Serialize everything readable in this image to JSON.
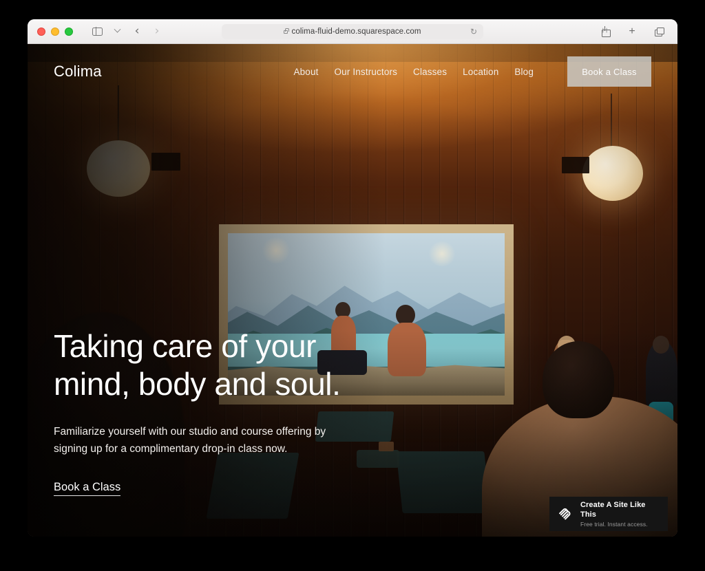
{
  "browser": {
    "url": "colima-fluid-demo.squarespace.com",
    "traffic_lights": [
      "close",
      "minimize",
      "maximize"
    ],
    "icons": {
      "sidebar": "sidebar-icon",
      "tab_group_chevron": "chevron-down-icon",
      "back": "‹",
      "forward": "›",
      "lock": "lock-icon",
      "reload": "↻",
      "share": "share-icon",
      "new_tab": "+",
      "tab_overview": "tab-overview-icon"
    }
  },
  "site": {
    "logo": "Colima",
    "nav": [
      {
        "label": "About"
      },
      {
        "label": "Our Instructors"
      },
      {
        "label": "Classes"
      },
      {
        "label": "Location"
      },
      {
        "label": "Blog"
      }
    ],
    "header_cta": "Book a Class"
  },
  "hero": {
    "heading_line1": "Taking care of your",
    "heading_line2": "mind, body and soul.",
    "body": "Familiarize yourself with our studio and course offering by signing up for a complimentary drop-in class now.",
    "cta": "Book a Class"
  },
  "badge": {
    "title": "Create A Site Like This",
    "subtitle": "Free trial. Instant access.",
    "logo": "squarespace-logo-icon"
  },
  "colors": {
    "page_background": "#000000",
    "toolbar_background": "#f1efef",
    "wood_warm": "#b9661f",
    "lamp_glow": "#fbe8c2",
    "lake_teal": "#89ced4",
    "badge_background": "#151515",
    "header_button": "#cac8c4"
  }
}
